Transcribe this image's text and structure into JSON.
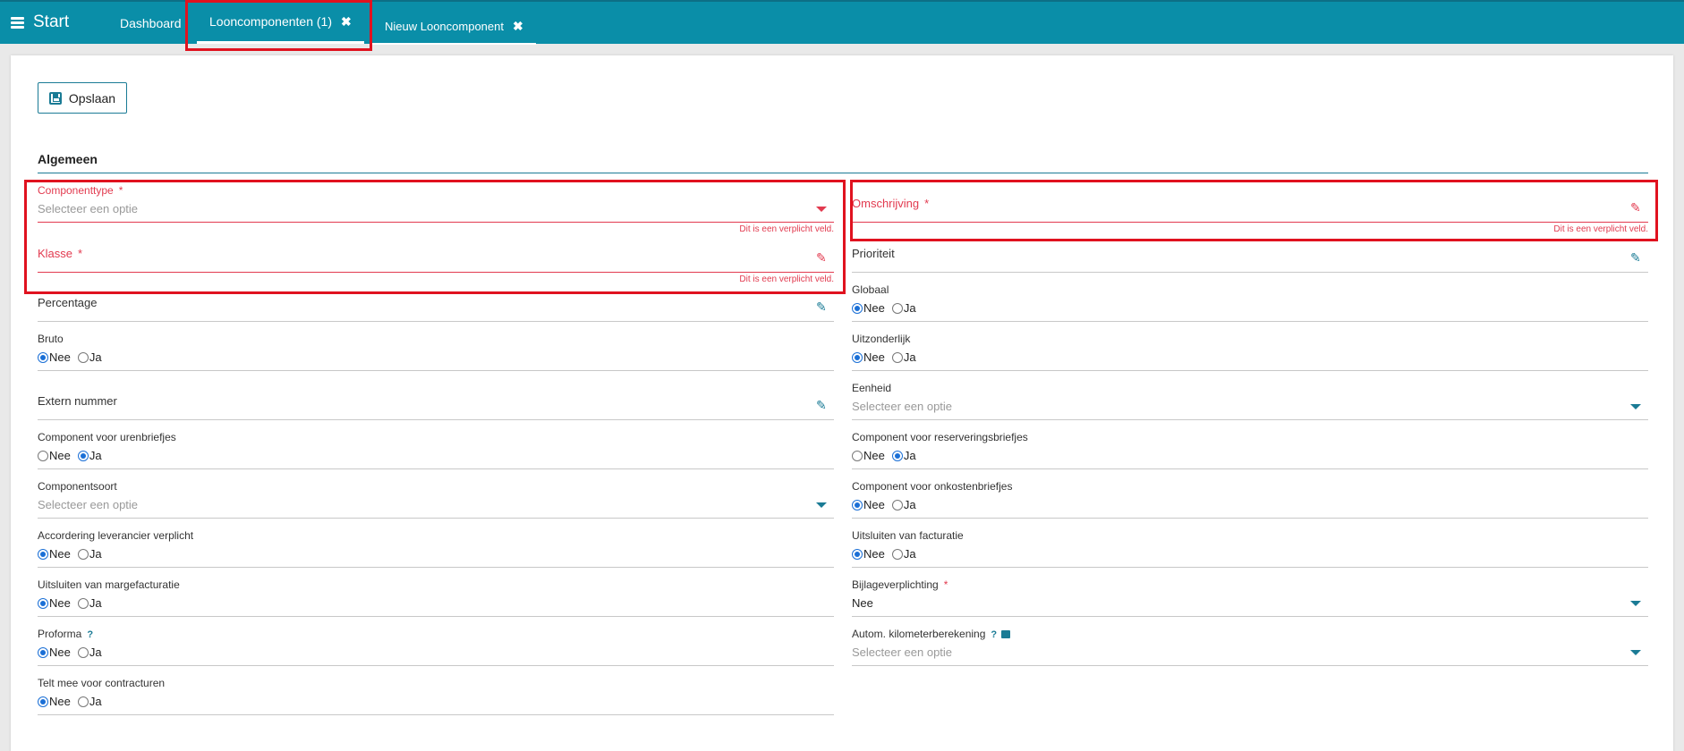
{
  "topbar": {
    "start": "Start",
    "tabs": [
      {
        "label": "Dashboard"
      },
      {
        "label": "Looncomponenten (1)",
        "close": "✖"
      },
      {
        "label": "Nieuw Looncomponent",
        "close": "✖"
      }
    ]
  },
  "toolbar": {
    "save_label": "Opslaan"
  },
  "section": {
    "title": "Algemeen"
  },
  "common": {
    "placeholder": "Selecteer een optie",
    "required_error": "Dit is een verplicht veld.",
    "nee": "Nee",
    "ja": "Ja",
    "req_mark": "*",
    "help_mark": "?"
  },
  "left": {
    "componenttype": {
      "label": "Componenttype"
    },
    "klasse": {
      "label": "Klasse"
    },
    "percentage": {
      "label": "Percentage"
    },
    "bruto": {
      "label": "Bruto",
      "selected": "Nee"
    },
    "extern_nummer": {
      "label": "Extern nummer"
    },
    "urenbriefjes": {
      "label": "Component voor urenbriefjes",
      "selected": "Ja"
    },
    "componentsoort": {
      "label": "Componentsoort"
    },
    "accordering": {
      "label": "Accordering leverancier verplicht",
      "selected": "Nee"
    },
    "margefacturatie": {
      "label": "Uitsluiten van margefacturatie",
      "selected": "Nee"
    },
    "proforma": {
      "label": "Proforma",
      "selected": "Nee"
    },
    "contracturen": {
      "label": "Telt mee voor contracturen",
      "selected": "Nee"
    }
  },
  "right": {
    "omschrijving": {
      "label": "Omschrijving"
    },
    "prioriteit": {
      "label": "Prioriteit"
    },
    "globaal": {
      "label": "Globaal",
      "selected": "Nee"
    },
    "uitzonderlijk": {
      "label": "Uitzonderlijk",
      "selected": "Nee"
    },
    "eenheid": {
      "label": "Eenheid"
    },
    "reserveringsbriefjes": {
      "label": "Component voor reserveringsbriefjes",
      "selected": "Ja"
    },
    "onkostenbriefjes": {
      "label": "Component voor onkostenbriefjes",
      "selected": "Nee"
    },
    "facturatie": {
      "label": "Uitsluiten van facturatie",
      "selected": "Nee"
    },
    "bijlageverplichting": {
      "label": "Bijlageverplichting",
      "value": "Nee"
    },
    "kilometer": {
      "label": "Autom. kilometerberekening"
    }
  },
  "colors": {
    "accent": "#0a8ea8",
    "error": "#e23a4f",
    "highlight": "#e0121f"
  }
}
